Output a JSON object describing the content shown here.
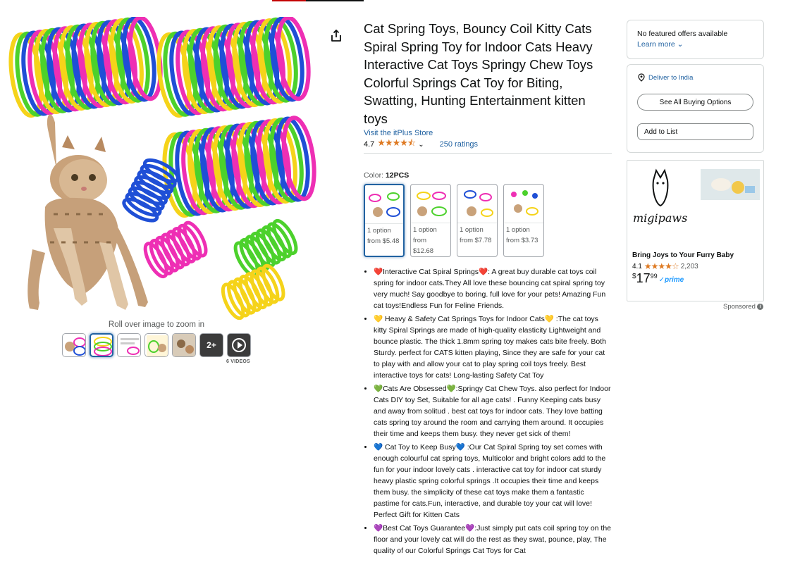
{
  "gallery": {
    "zoom_hint": "Roll over image to zoom in",
    "more_count": "2+",
    "videos_label": "6 VIDEOS"
  },
  "product": {
    "title": "Cat Spring Toys, Bouncy Coil Kitty Cats Spiral Spring Toy for Indoor Cats Heavy Interactive Cat Toys Springy Chew Toys Colorful Springs Cat Toy for Biting, Swatting, Hunting Entertainment kitten toys",
    "store_link": "Visit the itPlus Store",
    "rating": "4.7",
    "rating_stars": 4.7,
    "ratings_count": "250 ratings",
    "color_label": "Color:",
    "color_value": "12PCS"
  },
  "swatches": [
    {
      "options": "1 option",
      "price": "from $5.48"
    },
    {
      "options": "1 option",
      "price": "from $12.68"
    },
    {
      "options": "1 option",
      "price": "from $7.78"
    },
    {
      "options": "1 option",
      "price": "from $3.73"
    }
  ],
  "bullets": [
    {
      "text": "❤️Interactive Cat Spiral Springs❤️: A great buy durable cat toys coil spring for indoor cats.They All love these bouncing cat spiral spring toy very much! Say goodbye to boring. full love for your pets! Amazing Fun cat toys!Endless Fun for Feline Friends."
    },
    {
      "text": "💛 Heavy & Safety Cat Springs Toys for Indoor Cats💛 :The cat toys kitty Spiral Springs are made of high-quality elasticity Lightweight and bounce plastic. The thick 1.8mm spring toy makes cats bite freely. Both Sturdy. perfect for CATS kitten playing, Since they are safe for your cat to play with and allow your cat to play spring coil toys freely. Best interactive toys for cats! Long-lasting Safety Cat Toy"
    },
    {
      "text": "💚Cats Are Obsessed💚:Springy Cat Chew Toys. also perfect for Indoor Cats DIY toy Set, Suitable for all age cats! . Funny Keeping cats busy and away from solitud . best cat toys for indoor cats. They love batting cats spring toy around the room and carrying them around. It occupies their time and keeps them busy. they never get sick of them!"
    },
    {
      "text": "💙 Cat Toy to Keep Busy💙 :Our Cat Spiral Spring toy set comes with enough colourful cat spring toys, Multicolor and bright colors add to the fun for your indoor lovely cats . interactive cat toy for indoor cat sturdy heavy plastic spring colorful springs .It occupies their time and keeps them busy. the simplicity of these cat toys make them a fantastic pastime for cats.Fun, interactive, and durable toy your cat will love! Perfect Gift for Kitten Cats"
    },
    {
      "text": "💜Best Cat Toys Guarantee💜:Just simply put cats coil spring toy on the floor and your lovely cat will do the rest as they swat, pounce, play, The quality of our Colorful Springs Cat Toys for Cat"
    }
  ],
  "offer_box": {
    "no_offers": "No featured offers available",
    "learn_more": "Learn more"
  },
  "buy_box": {
    "deliver": "Deliver to India",
    "see_all": "See All Buying Options",
    "add_to_list": "Add to List"
  },
  "ad": {
    "brand": "migipaws",
    "title": "Bring Joys to Your Furry Baby",
    "rating": "4.1",
    "rating_stars": 4.1,
    "count": "2,203",
    "currency": "$",
    "price_whole": "17",
    "price_fraction": "99",
    "prime": "✓prime",
    "sponsored": "Sponsored"
  },
  "colors": {
    "link": "#2162a1",
    "star": "#de7921",
    "coil_yellow": "#f5d31a",
    "coil_green": "#4cd12c",
    "coil_blue": "#1f4fd6",
    "coil_pink": "#ee2fb4"
  }
}
